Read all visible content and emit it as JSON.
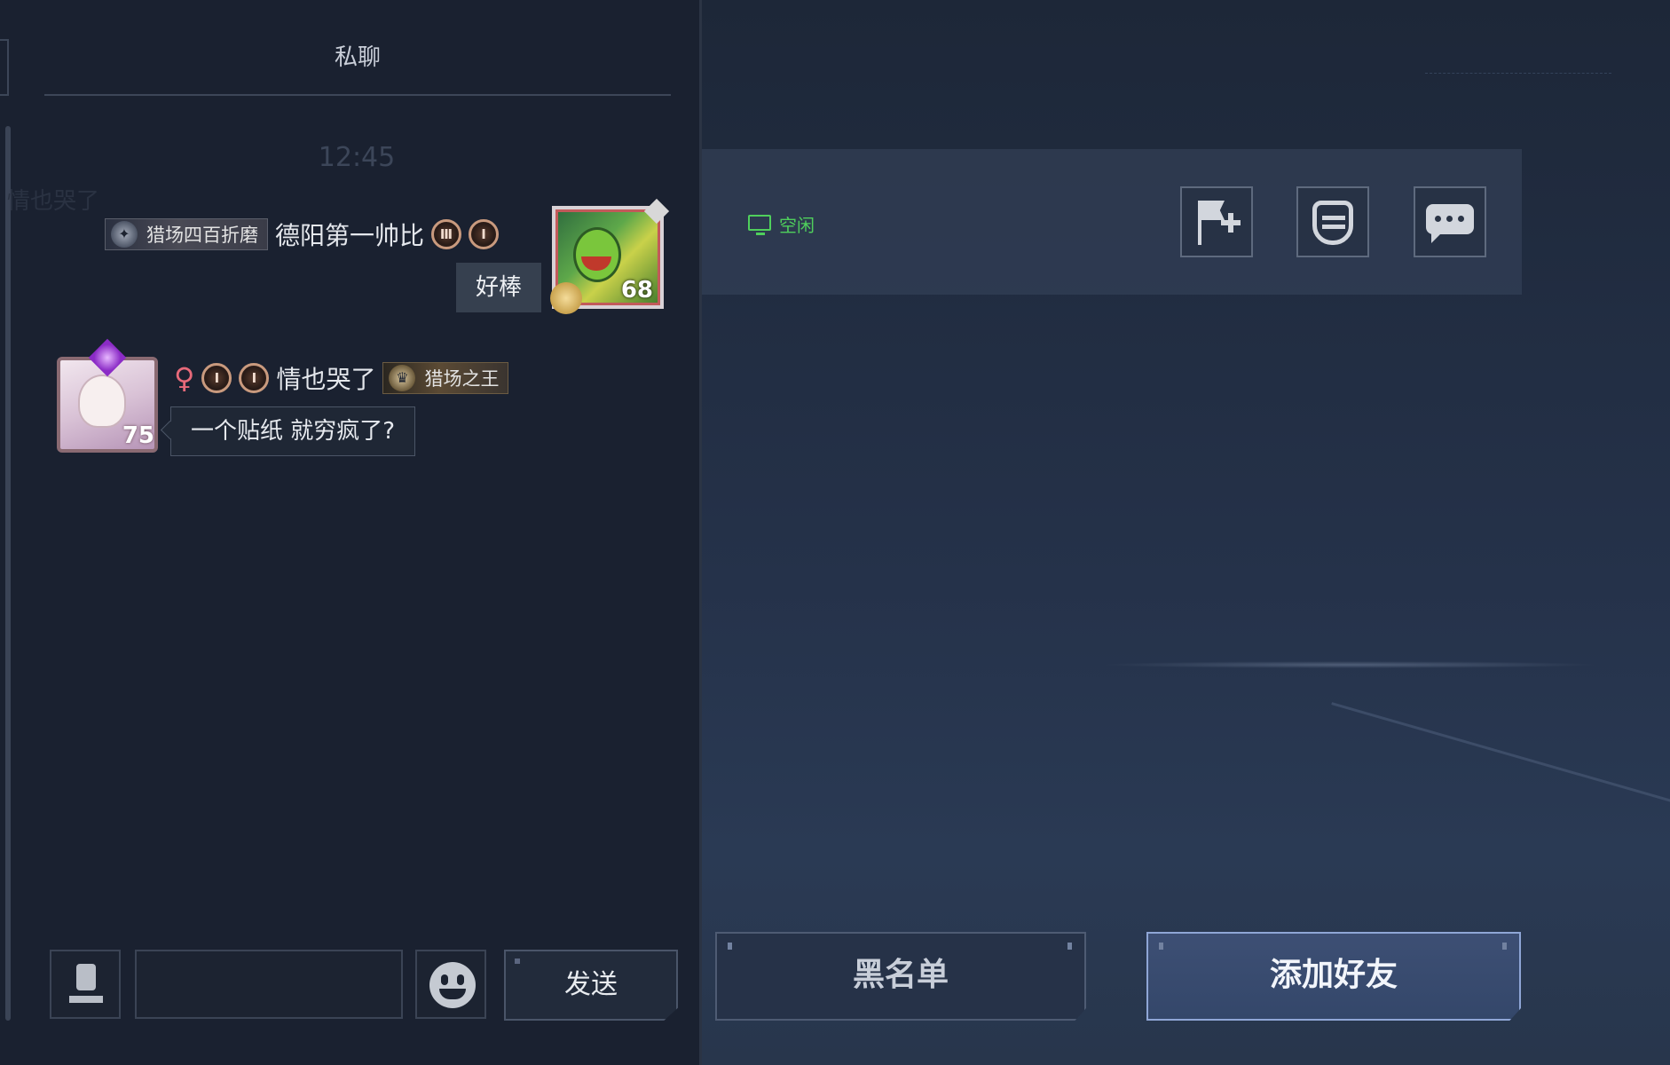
{
  "chat": {
    "title": "私聊",
    "timestamp": "12:45",
    "ghost_name": "情也哭了",
    "messages": [
      {
        "side": "right",
        "title_badge": "猎场四百折磨",
        "username": "德阳第一帅比",
        "rank_icons": [
          "Ⅲ",
          "I"
        ],
        "avatar_level": "68",
        "text": "好棒"
      },
      {
        "side": "left",
        "gender": "♀",
        "rank_icons": [
          "I",
          "I"
        ],
        "username": "情也哭了",
        "title_badge": "猎场之王",
        "avatar_level": "75",
        "text": "一个贴纸 就穷疯了?"
      }
    ],
    "input": {
      "value": "",
      "placeholder": ""
    },
    "send_label": "发送",
    "icons": {
      "voice": "microphone-icon",
      "emoji": "smiley-icon"
    }
  },
  "profile": {
    "status": {
      "icon": "monitor-icon",
      "label": "空闲",
      "color": "#4fcf5c"
    },
    "actions": [
      {
        "name": "report",
        "icon": "flag-plus-icon"
      },
      {
        "name": "gift",
        "icon": "gift-icon"
      },
      {
        "name": "chat",
        "icon": "speech-bubble-icon"
      }
    ],
    "buttons": {
      "blacklist": "黑名单",
      "add_friend": "添加好友"
    }
  },
  "colors": {
    "panel_bg": "#1a2130",
    "accent_blue": "#8fa6d6",
    "status_green": "#4fcf5c",
    "female": "#e86a7a"
  }
}
